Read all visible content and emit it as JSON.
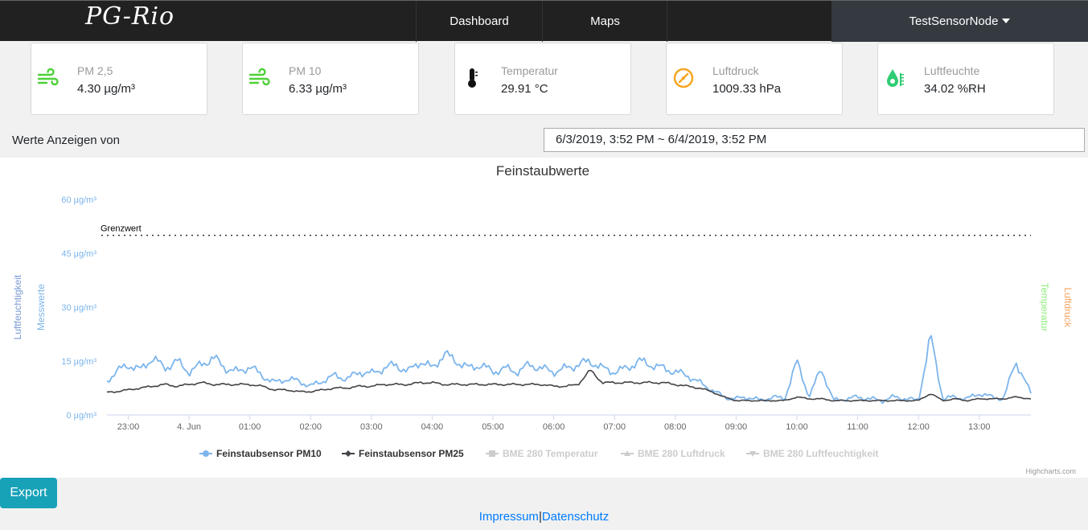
{
  "nav": {
    "brand": "PG-Rio",
    "dashboard": "Dashboard",
    "maps": "Maps",
    "user": "TestSensorNode"
  },
  "cards": [
    {
      "label": "PM 2,5",
      "value": "4.30 µg/m³",
      "icon": "wind-icon",
      "color": "#4cd137"
    },
    {
      "label": "PM 10",
      "value": "6.33 µg/m³",
      "icon": "wind-icon",
      "color": "#4cd137"
    },
    {
      "label": "Temperatur",
      "value": "29.91 °C",
      "icon": "thermometer-icon",
      "color": "#111111"
    },
    {
      "label": "Luftdruck",
      "value": "1009.33 hPa",
      "icon": "gauge-icon",
      "color": "#f5a623"
    },
    {
      "label": "Luftfeuchte",
      "value": "34.02 %RH",
      "icon": "humidity-icon",
      "color": "#2ecc71"
    }
  ],
  "range": {
    "label": "Werte Anzeigen von",
    "value": "6/3/2019, 3:52 PM ~ 6/4/2019, 3:52 PM"
  },
  "export_label": "Export",
  "footer": {
    "impressum": "Impressum",
    "separator": "|",
    "datenschutz": "Datenschutz"
  },
  "chart_data": {
    "type": "line",
    "title": "Feinstaubwerte",
    "credits": "Highcharts.com",
    "ylabel_left_outer": "Luftfeuchtigkeit",
    "ylabel_left_inner": "Messwerte",
    "ylabel_right_inner": "Temperatur",
    "ylabel_right_outer": "Luftdruck",
    "y_unit": "µg/m³",
    "yticks": [
      "0 µg/m³",
      "15 µg/m³",
      "30 µg/m³",
      "45 µg/m³",
      "60 µg/m³"
    ],
    "ylim": [
      0,
      60
    ],
    "xticks": [
      "23:00",
      "4. Jun",
      "01:00",
      "02:00",
      "03:00",
      "04:00",
      "05:00",
      "06:00",
      "07:00",
      "08:00",
      "09:00",
      "10:00",
      "11:00",
      "12:00",
      "13:00"
    ],
    "x_start_hour": 22.65,
    "x_end_hour": 37.85,
    "threshold": {
      "label": "Grenzwert",
      "value": 50
    },
    "legend": [
      {
        "name": "Feinstaubsensor PM10",
        "color": "#7cb5ec",
        "active": true,
        "marker": "circle"
      },
      {
        "name": "Feinstaubsensor PM25",
        "color": "#434348",
        "active": true,
        "marker": "diamond"
      },
      {
        "name": "BME 280 Temperatur",
        "color": "#cccccc",
        "active": false,
        "marker": "square"
      },
      {
        "name": "BME 280 Luftdruck",
        "color": "#cccccc",
        "active": false,
        "marker": "triangle"
      },
      {
        "name": "BME 280 Luftfeuchtigkeit",
        "color": "#cccccc",
        "active": false,
        "marker": "triangle-down"
      }
    ],
    "series": [
      {
        "name": "Feinstaubsensor PM10",
        "color": "#7cb5ec",
        "hours": [
          22.65,
          22.8,
          23.0,
          23.2,
          23.4,
          23.6,
          23.8,
          24.0,
          24.2,
          24.4,
          24.6,
          24.8,
          25.0,
          25.2,
          25.4,
          25.6,
          25.8,
          26.0,
          26.2,
          26.4,
          26.6,
          26.8,
          27.0,
          27.2,
          27.4,
          27.6,
          27.8,
          28.0,
          28.2,
          28.4,
          28.6,
          28.8,
          29.0,
          29.2,
          29.4,
          29.6,
          29.8,
          30.0,
          30.2,
          30.4,
          30.6,
          30.8,
          31.0,
          31.2,
          31.4,
          31.6,
          31.8,
          32.0,
          32.2,
          32.4,
          32.6,
          32.8,
          33.0,
          33.2,
          33.4,
          33.6,
          33.8,
          34.0,
          34.2,
          34.4,
          34.6,
          34.8,
          35.0,
          35.2,
          35.4,
          35.6,
          35.8,
          36.0,
          36.2,
          36.4,
          36.6,
          36.8,
          37.0,
          37.2,
          37.4,
          37.6,
          37.85
        ],
        "values": [
          9.5,
          12,
          14,
          12.5,
          16,
          13,
          15,
          12,
          14,
          16,
          13,
          12,
          13.5,
          11,
          9,
          10,
          9.5,
          8,
          9.5,
          11,
          10,
          12,
          11.5,
          13,
          14,
          12,
          15,
          13,
          17,
          15,
          13,
          14,
          12,
          13,
          12,
          14,
          13,
          12,
          13,
          14,
          15,
          13,
          12,
          13,
          15,
          14,
          13,
          12,
          11,
          9,
          7,
          5,
          4.5,
          5,
          4,
          5,
          4.5,
          15,
          5,
          13,
          4,
          4.5,
          5,
          4.5,
          4,
          5,
          4.5,
          4,
          22,
          4.5,
          5,
          4.5,
          6,
          5,
          4.5,
          15,
          6
        ]
      },
      {
        "name": "Feinstaubsensor PM25",
        "color": "#434348",
        "hours": [
          22.65,
          22.8,
          23.0,
          23.2,
          23.4,
          23.6,
          23.8,
          24.0,
          24.2,
          24.4,
          24.6,
          24.8,
          25.0,
          25.2,
          25.4,
          25.6,
          25.8,
          26.0,
          26.2,
          26.4,
          26.6,
          26.8,
          27.0,
          27.2,
          27.4,
          27.6,
          27.8,
          28.0,
          28.2,
          28.4,
          28.6,
          28.8,
          29.0,
          29.2,
          29.4,
          29.6,
          29.8,
          30.0,
          30.2,
          30.4,
          30.6,
          30.8,
          31.0,
          31.2,
          31.4,
          31.6,
          31.8,
          32.0,
          32.2,
          32.4,
          32.6,
          32.8,
          33.0,
          33.2,
          33.4,
          33.6,
          33.8,
          34.0,
          34.2,
          34.4,
          34.6,
          34.8,
          35.0,
          35.2,
          35.4,
          35.6,
          35.8,
          36.0,
          36.2,
          36.4,
          36.6,
          36.8,
          37.0,
          37.2,
          37.4,
          37.6,
          37.85
        ],
        "values": [
          6.3,
          6.5,
          7,
          7.5,
          8,
          8.5,
          8,
          8.5,
          9,
          8.5,
          8.5,
          8.5,
          8.5,
          8,
          7,
          7,
          6.5,
          6.5,
          7,
          7.5,
          7.5,
          8,
          8,
          8.5,
          8.5,
          8.5,
          9,
          9,
          8.5,
          8.5,
          8.5,
          8.5,
          8.5,
          8.5,
          8.5,
          8.5,
          8.5,
          8,
          8,
          8.5,
          12.5,
          9,
          9,
          9,
          9,
          9,
          9,
          8.5,
          8,
          7.5,
          6.5,
          5,
          4,
          4,
          4,
          4,
          4,
          5,
          4.5,
          4.5,
          4,
          4,
          4,
          4,
          4,
          4,
          4,
          4,
          6,
          4,
          4.5,
          4,
          4.5,
          4.5,
          4.5,
          5,
          4.5
        ]
      }
    ]
  }
}
